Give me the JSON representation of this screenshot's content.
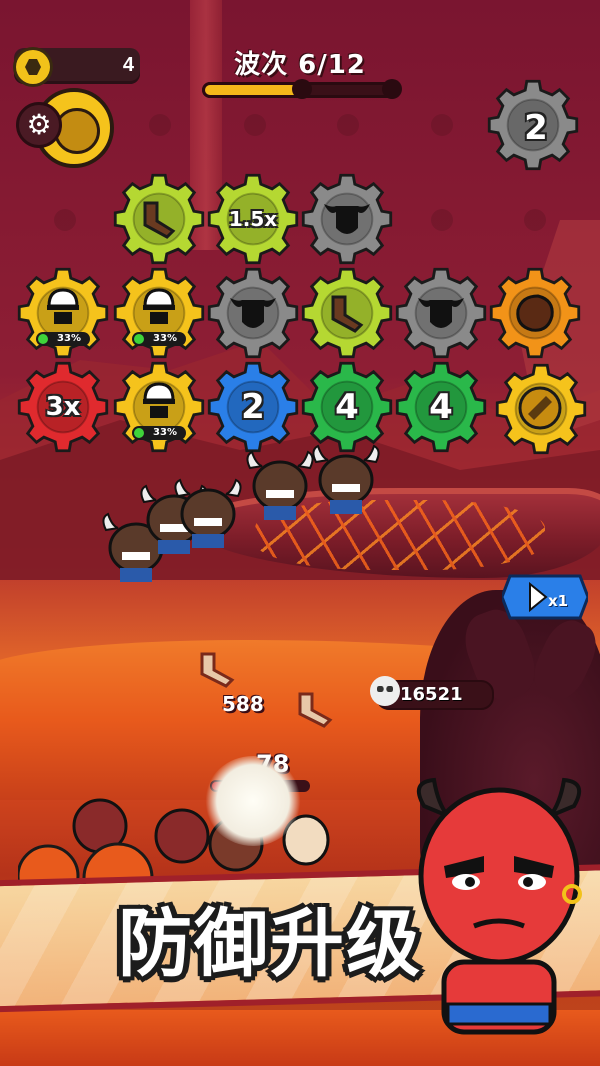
{
  "hud": {
    "coins": "4",
    "wave_label": "波次 6/12",
    "wave_progress": 0.5,
    "level_gear": "2",
    "speed_label": "x1"
  },
  "colors": {
    "yellow": "#f5c31c",
    "yellow_green": "#b5d832",
    "gray": "#8a8a8a",
    "orange": "#f29318",
    "red": "#e02a2e",
    "blue": "#2a7fe8",
    "green": "#2ab84a"
  },
  "grid": {
    "row1": [
      {
        "color": "yellow_green",
        "icon": "boomerang-icon",
        "text": ""
      },
      {
        "color": "yellow_green",
        "icon": "",
        "text": "1.5x"
      },
      {
        "color": "gray",
        "icon": "bull-head-icon",
        "text": ""
      }
    ],
    "row2": [
      {
        "color": "yellow",
        "icon": "worker-helmet-icon",
        "text": "",
        "pct": "33%"
      },
      {
        "color": "yellow",
        "icon": "worker-helmet-icon",
        "text": "",
        "pct": "33%"
      },
      {
        "color": "gray",
        "icon": "bull-head-icon",
        "text": ""
      },
      {
        "color": "yellow_green",
        "icon": "boomerang-icon",
        "text": ""
      },
      {
        "color": "gray",
        "icon": "bull-head-icon",
        "text": ""
      },
      {
        "color": "orange",
        "icon": "rock-icon",
        "text": ""
      }
    ],
    "row3": [
      {
        "color": "red",
        "icon": "",
        "text": "3x"
      },
      {
        "color": "yellow",
        "icon": "worker-helmet-icon",
        "text": "",
        "pct": "33%"
      },
      {
        "color": "blue",
        "icon": "",
        "text": "2"
      },
      {
        "color": "green",
        "icon": "",
        "text": "4"
      },
      {
        "color": "green",
        "icon": "",
        "text": "4"
      },
      {
        "color": "yellow",
        "icon": "coin-slot-icon",
        "text": ""
      }
    ]
  },
  "battle": {
    "enemy_hp": "16521",
    "damage_numbers": [
      "588",
      "78"
    ]
  },
  "banner": {
    "title": "防御升级"
  }
}
